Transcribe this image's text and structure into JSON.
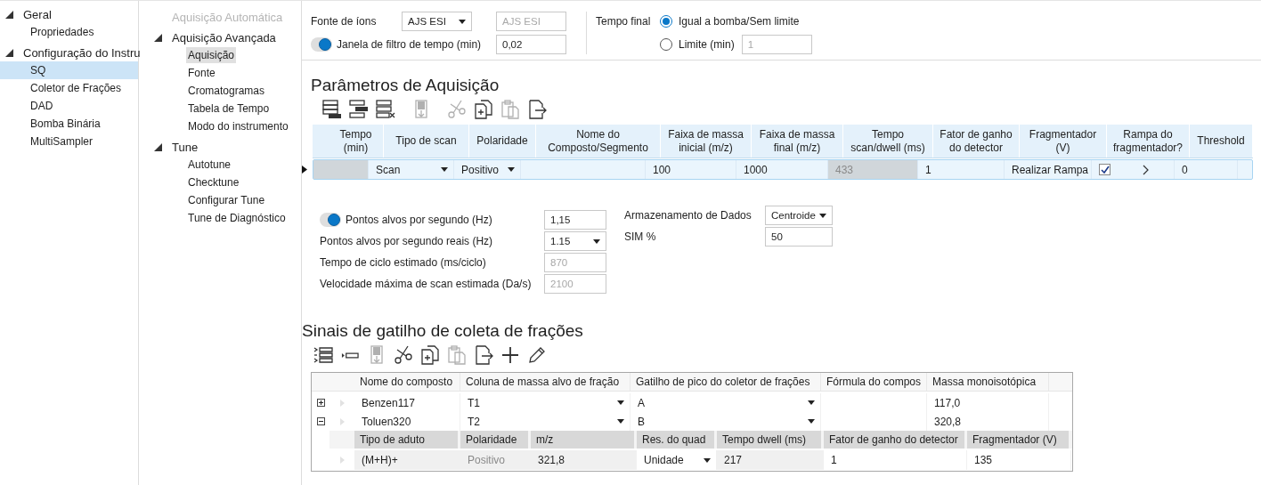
{
  "nav": {
    "items": [
      {
        "label": "Geral",
        "expanded": true,
        "selected": false,
        "children": [
          {
            "label": "Propriedades",
            "selected": false
          }
        ]
      },
      {
        "label": "Configuração do Instru",
        "expanded": true,
        "selected": false,
        "children": [
          {
            "label": "SQ",
            "selected": true
          },
          {
            "label": "Coletor de Frações",
            "selected": false
          },
          {
            "label": "DAD",
            "selected": false
          },
          {
            "label": "Bomba Binária",
            "selected": false
          },
          {
            "label": "MultiSampler",
            "selected": false
          }
        ]
      }
    ]
  },
  "subnav": {
    "items": [
      {
        "label": "Aquisição Automática",
        "disabled": true,
        "selected": false
      },
      {
        "label": "Aquisição Avançada",
        "disabled": false,
        "expanded": true,
        "selected": false,
        "children": [
          {
            "label": "Aquisição",
            "selected": true
          },
          {
            "label": "Fonte",
            "selected": false
          },
          {
            "label": "Cromatogramas",
            "selected": false
          },
          {
            "label": "Tabela de Tempo",
            "selected": false
          },
          {
            "label": "Modo do instrumento",
            "selected": false
          }
        ]
      },
      {
        "label": "Tune",
        "disabled": false,
        "expanded": true,
        "selected": false,
        "children": [
          {
            "label": "Autotune",
            "selected": false
          },
          {
            "label": "Checktune",
            "selected": false
          },
          {
            "label": "Configurar Tune",
            "selected": false
          },
          {
            "label": "Tune de Diagnóstico",
            "selected": false
          }
        ]
      }
    ]
  },
  "ion_source": {
    "label": "Fonte de íons",
    "value": "AJS ESI",
    "readonly_value": "AJS ESI"
  },
  "time_filter": {
    "on": true,
    "label": "Janela de filtro de tempo (min)",
    "value": "0,02"
  },
  "end_time": {
    "label": "Tempo final",
    "options": [
      {
        "label": "Igual a bomba/Sem limite",
        "selected": true
      },
      {
        "label": "Limite (min)",
        "selected": false,
        "value": "1"
      }
    ]
  },
  "acquisition": {
    "title": "Parâmetros de Aquisição",
    "toolbar": [
      {
        "buttons": [
          {
            "kind": "insert-rows",
            "disabled": false
          },
          {
            "kind": "append-rows",
            "disabled": false
          },
          {
            "kind": "delete-rows",
            "disabled": false
          }
        ]
      },
      {
        "buttons": [
          {
            "kind": "fill-down",
            "disabled": true
          }
        ]
      },
      {
        "buttons": [
          {
            "kind": "cut",
            "disabled": true
          },
          {
            "kind": "copy",
            "disabled": false
          },
          {
            "kind": "paste",
            "disabled": true
          },
          {
            "kind": "export",
            "disabled": false
          }
        ]
      }
    ],
    "columns": [
      "Tempo (min)",
      "Tipo de scan",
      "Polaridade",
      "Nome do Composto/Segmento",
      "Faixa de massa inicial (m/z)",
      "Faixa de massa final (m/z)",
      "Tempo scan/dwell (ms)",
      "Fator de ganho do detector",
      "Fragmentador (V)",
      "Rampa do fragmentador?",
      "Threshold"
    ],
    "rows": [
      {
        "selected": true,
        "cells": [
          {
            "kind": "readonly"
          },
          {
            "kind": "dropdown",
            "value": "Scan"
          },
          {
            "kind": "dropdown",
            "value": "Positivo"
          },
          {
            "kind": "text"
          },
          {
            "kind": "text",
            "value": "100"
          },
          {
            "kind": "text",
            "value": "1000"
          },
          {
            "kind": "disabled",
            "value": "433"
          },
          {
            "kind": "text",
            "value": "1"
          },
          {
            "kind": "text",
            "value": "Realizar Rampa"
          },
          {
            "kind": "checkbox",
            "checked": true
          },
          {
            "kind": "text",
            "value": "0"
          }
        ]
      }
    ]
  },
  "settings": {
    "left": [
      {
        "kind": "toggle",
        "on": true,
        "label": "Pontos alvos por segundo (Hz)",
        "value": "1,15"
      },
      {
        "kind": "dropdown",
        "label": "Pontos alvos por segundo reais (Hz)",
        "value": "1.15"
      },
      {
        "kind": "readonly",
        "label": "Tempo de ciclo estimado (ms/ciclo)",
        "value": "870"
      },
      {
        "kind": "readonly",
        "label": "Velocidade máxima de scan estimada (Da/s)",
        "value": "2100"
      }
    ],
    "right": [
      {
        "kind": "dropdown",
        "label": "Armazenamento de Dados",
        "value": "Centroide"
      },
      {
        "kind": "text",
        "label": "SIM %",
        "value": "50"
      }
    ]
  },
  "fractions": {
    "title": "Sinais de gatilho de coleta de frações",
    "toolbar": [
      {
        "buttons": [
          {
            "kind": "list-insert",
            "disabled": false
          },
          {
            "kind": "remove-row",
            "disabled": false
          },
          {
            "kind": "fill-down",
            "disabled": true
          },
          {
            "kind": "cut",
            "disabled": false
          },
          {
            "kind": "copy",
            "disabled": false
          },
          {
            "kind": "paste",
            "disabled": true
          },
          {
            "kind": "export",
            "disabled": false
          },
          {
            "kind": "add",
            "disabled": false
          },
          {
            "kind": "edit",
            "disabled": false
          }
        ]
      }
    ],
    "columns": [
      "Nome do composto",
      "Coluna de massa alvo de fração",
      "Gatilho de pico do coletor de frações",
      "Fórmula do compos",
      "Massa monoisotópica"
    ],
    "rows": [
      {
        "expanded": false,
        "cells": [
          {
            "kind": "text",
            "value": "Benzen117"
          },
          {
            "kind": "dropdown",
            "value": "T1"
          },
          {
            "kind": "dropdown",
            "value": "A"
          },
          {
            "kind": "text"
          },
          {
            "kind": "text",
            "value": "117,0"
          }
        ]
      },
      {
        "expanded": true,
        "cells": [
          {
            "kind": "text",
            "value": "Toluen320"
          },
          {
            "kind": "dropdown",
            "value": "T2"
          },
          {
            "kind": "dropdown",
            "value": "B"
          },
          {
            "kind": "text"
          },
          {
            "kind": "text",
            "value": "320,8"
          }
        ],
        "details": {
          "columns": [
            "Tipo de aduto",
            "Polaridade",
            "m/z",
            "Res. do quad",
            "Tempo dwell (ms)",
            "Fator de ganho do detector",
            "Fragmentador (V)"
          ],
          "rows": [
            {
              "cells": [
                {
                  "kind": "readonly",
                  "value": "(M+H)+"
                },
                {
                  "kind": "disabled",
                  "value": "Positivo"
                },
                {
                  "kind": "readonly",
                  "value": "321,8"
                },
                {
                  "kind": "dropdown",
                  "value": "Unidade"
                },
                {
                  "kind": "readonly",
                  "value": "217"
                },
                {
                  "kind": "text",
                  "value": "1"
                },
                {
                  "kind": "text",
                  "value": "135"
                }
              ]
            }
          ]
        }
      }
    ]
  }
}
